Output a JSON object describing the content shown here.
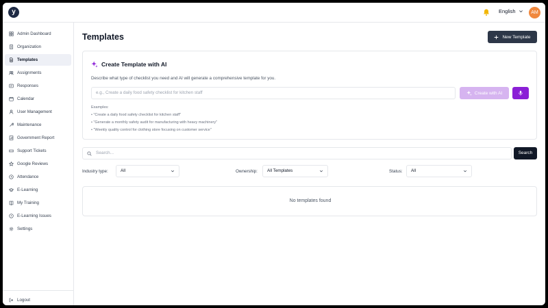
{
  "header": {
    "logo_letter": "y",
    "language": "English",
    "avatar_initials": "AM"
  },
  "sidebar": {
    "items": [
      {
        "label": "Admin Dashboard",
        "icon": "grid-icon"
      },
      {
        "label": "Organization",
        "icon": "building-icon"
      },
      {
        "label": "Templates",
        "icon": "document-icon",
        "active": true
      },
      {
        "label": "Assignments",
        "icon": "users-icon"
      },
      {
        "label": "Responses",
        "icon": "reply-icon"
      },
      {
        "label": "Calendar",
        "icon": "calendar-icon"
      },
      {
        "label": "User Management",
        "icon": "user-icon"
      },
      {
        "label": "Maintenance",
        "icon": "wrench-icon"
      },
      {
        "label": "Government Report",
        "icon": "report-icon"
      },
      {
        "label": "Support Tickets",
        "icon": "ticket-icon"
      },
      {
        "label": "Google Reviews",
        "icon": "star-icon"
      },
      {
        "label": "Attendance",
        "icon": "clock-icon"
      },
      {
        "label": "E-Learning",
        "icon": "graduation-icon"
      },
      {
        "label": "My Training",
        "icon": "book-icon"
      },
      {
        "label": "E-Learning Issues",
        "icon": "alert-icon"
      },
      {
        "label": "Settings",
        "icon": "gear-icon"
      }
    ],
    "logout_label": "Logout"
  },
  "main": {
    "title": "Templates",
    "new_template_label": "New Template",
    "ai_card": {
      "title": "Create Template with AI",
      "description": "Describe what type of checklist you need and AI will generate a comprehensive template for you.",
      "input_placeholder": "e.g., Create a daily food safety checklist for kitchen staff",
      "create_button_label": "Create with AI",
      "examples_label": "Examples:",
      "examples": [
        "• \"Create a daily food safety checklist for kitchen staff\"",
        "• \"Generate a monthly safety audit for manufacturing with heavy machinery\"",
        "• \"Weekly quality control for clothing store focusing on customer service\""
      ]
    },
    "search": {
      "placeholder": "Search...",
      "button_label": "Search"
    },
    "filters": {
      "industry_label": "Industry type:",
      "industry_value": "All",
      "ownership_label": "Ownership:",
      "ownership_value": "All Templates",
      "status_label": "Status:",
      "status_value": "All"
    },
    "empty_message": "No templates found"
  },
  "colors": {
    "primary_dark": "#2d3748",
    "ai_purple": "#8b1fd6",
    "ai_purple_light": "#d6b4f0",
    "avatar_orange": "#f0883e"
  }
}
